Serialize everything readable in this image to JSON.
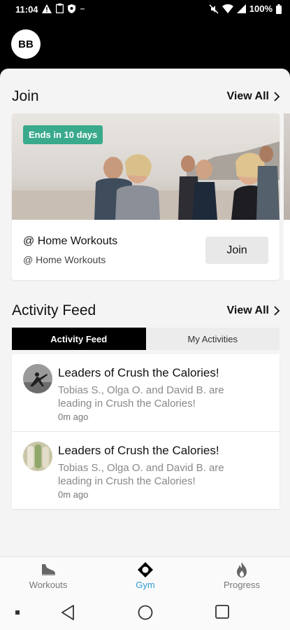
{
  "status_bar": {
    "time": "11:04",
    "battery": "100%",
    "left_icons": [
      "warning-icon",
      "clipboard-icon",
      "shield-icon",
      "dash-icon"
    ],
    "right_icons": [
      "mute-icon",
      "wifi-icon",
      "signal-icon",
      "battery-icon"
    ]
  },
  "header": {
    "avatar_initials": "BB"
  },
  "join_section": {
    "title": "Join",
    "view_all": "View All",
    "card": {
      "badge": "Ends in 10 days",
      "title": "@ Home Workouts",
      "subtitle": "@ Home Workouts",
      "button": "Join"
    }
  },
  "activity_section": {
    "title": "Activity Feed",
    "view_all": "View All",
    "tabs": [
      {
        "label": "Activity Feed",
        "active": true
      },
      {
        "label": "My Activities",
        "active": false
      }
    ],
    "items": [
      {
        "title": "Leaders of Crush the Calories!",
        "description": "Tobias S., Olga O. and David B. are leading in Crush the Calories!",
        "time": "0m ago"
      },
      {
        "title": "Leaders of Crush the Calories!",
        "description": "Tobias S., Olga O. and David B. are leading in Crush the Calories!",
        "time": "0m ago"
      }
    ]
  },
  "bottom_nav": {
    "items": [
      {
        "label": "Workouts",
        "icon": "shoe-icon",
        "active": false
      },
      {
        "label": "Gym",
        "icon": "gym-icon",
        "active": true
      },
      {
        "label": "Progress",
        "icon": "flame-icon",
        "active": false
      }
    ],
    "active_color": "#2f9bd3"
  },
  "colors": {
    "badge": "#3aaa8c",
    "header_bg": "#000000",
    "accent": "#2f9bd3"
  }
}
